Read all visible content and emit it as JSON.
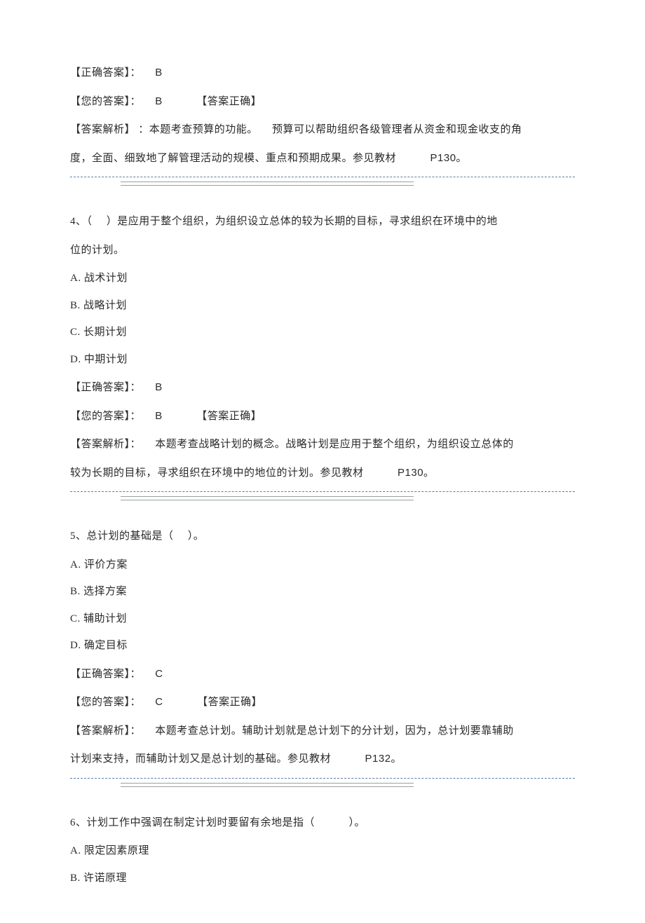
{
  "q3": {
    "correct_label": "【正确答案】：",
    "correct_val": "B",
    "your_label": "【您的答案】：",
    "your_val": "B",
    "result": "【答案正确】",
    "analysis_label": "【答案解析】",
    "analysis_1": "：本题考查预算的功能。",
    "analysis_2": "预算可以帮助组织各级管理者从资金和现金收支的角",
    "analysis_3": "度，全面、细致地了解管理活动的规模、重点和预期成果。参见教材",
    "ref": "P130。"
  },
  "q4": {
    "number": "4、（",
    "stem_1": "）是应用于整个组织，为组织设立总体的较为长期的目标，寻求组织在环境中的地",
    "stem_2": "位的计划。",
    "optA": "A. 战术计划",
    "optB": "B. 战略计划",
    "optC": "C. 长期计划",
    "optD": "D. 中期计划",
    "correct_label": "【正确答案】：",
    "correct_val": "B",
    "your_label": "【您的答案】：",
    "your_val": "B",
    "result": "【答案正确】",
    "analysis_label": "【答案解析】：",
    "analysis_1": "本题考查战略计划的概念。战略计划是应用于整个组织，为组织设立总体的",
    "analysis_2": "较为长期的目标，寻求组织在环境中的地位的计划。参见教材",
    "ref": "P130。"
  },
  "q5": {
    "number": "5、总计划的基础是（",
    "stem_tail": "）。",
    "optA": "A. 评价方案",
    "optB": "B. 选择方案",
    "optC": "C. 辅助计划",
    "optD": "D. 确定目标",
    "correct_label": "【正确答案】：",
    "correct_val": "C",
    "your_label": "【您的答案】：",
    "your_val": "C",
    "result": "【答案正确】",
    "analysis_label": "【答案解析】：",
    "analysis_1": "本题考查总计划。辅助计划就是总计划下的分计划，因为，总计划要靠辅助",
    "analysis_2": "计划来支持，而辅助计划又是总计划的基础。参见教材",
    "ref": "P132。"
  },
  "q6": {
    "number": "6、计划工作中强调在制定计划时要留有余地是指（",
    "stem_tail": "）。",
    "optA": "A. 限定因素原理",
    "optB": "B. 许诺原理"
  }
}
